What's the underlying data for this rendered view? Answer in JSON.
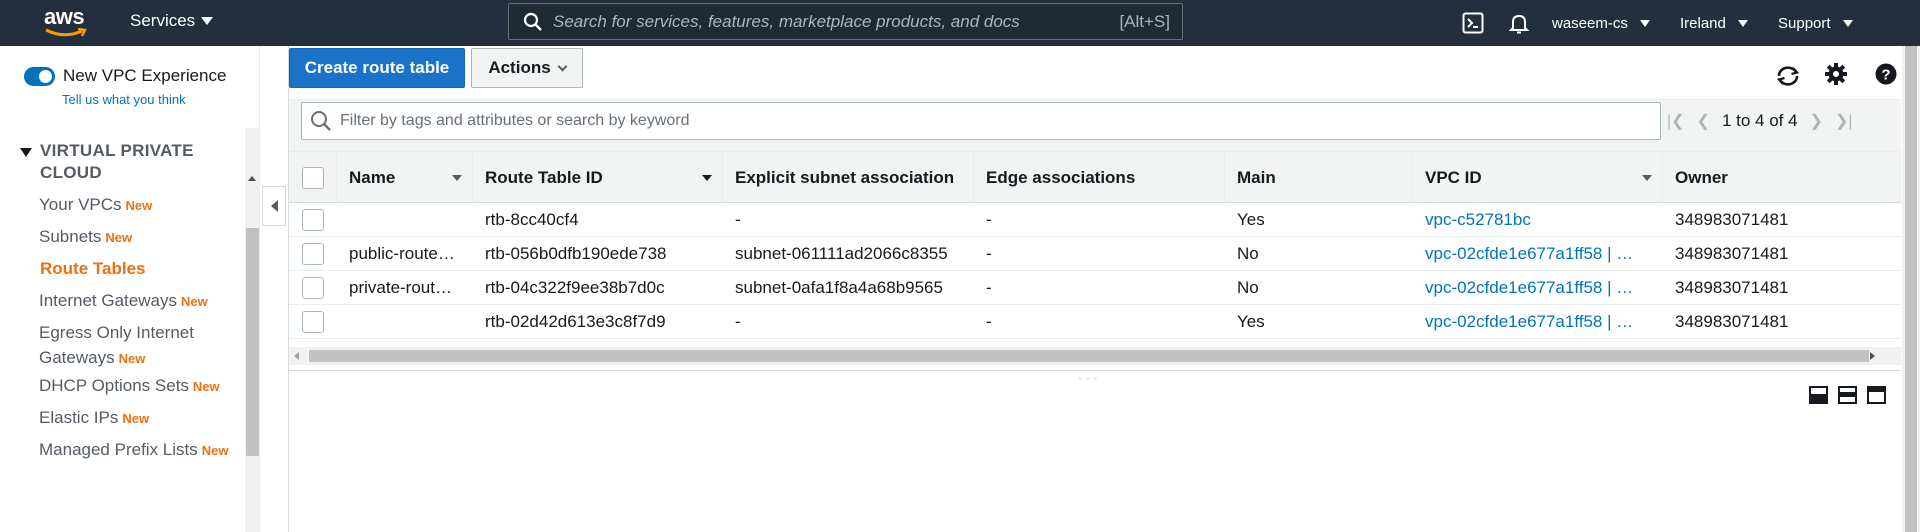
{
  "topnav": {
    "logo_text": "aws",
    "services_label": "Services",
    "search_placeholder": "Search for services, features, marketplace products, and docs",
    "search_shortcut": "[Alt+S]",
    "account_label": "waseem-cs",
    "region_label": "Ireland",
    "support_label": "Support",
    "icons": [
      "cloudshell-icon",
      "bell-icon"
    ]
  },
  "sidebar": {
    "toggle_label": "New VPC Experience",
    "toggle_on": true,
    "tell_us_link": "Tell us what you think",
    "section_title": "VIRTUAL PRIVATE CLOUD",
    "new_badge": "New",
    "items": [
      {
        "label": "Your VPCs",
        "badge": "New"
      },
      {
        "label": "Subnets",
        "badge": "New"
      },
      {
        "label": "Route Tables",
        "badge": "",
        "active": true
      },
      {
        "label": "Internet Gateways",
        "badge": "New"
      },
      {
        "label": "Egress Only Internet Gateways",
        "badge": "New"
      },
      {
        "label": "DHCP Options Sets",
        "badge": "New"
      },
      {
        "label": "Elastic IPs",
        "badge": "New"
      },
      {
        "label": "Managed Prefix Lists",
        "badge": "New"
      }
    ]
  },
  "toolbar": {
    "create_label": "Create route table",
    "actions_label": "Actions",
    "icons": [
      "refresh-icon",
      "settings-icon",
      "help-icon"
    ]
  },
  "filter": {
    "placeholder": "Filter by tags and attributes or search by keyword"
  },
  "pager": {
    "text": "1 to 4 of 4"
  },
  "table": {
    "columns": [
      "Name",
      "Route Table ID",
      "Explicit subnet association",
      "Edge associations",
      "Main",
      "VPC ID",
      "Owner"
    ],
    "rows": [
      {
        "name": "",
        "id": "rtb-8cc40cf4",
        "subnet": "-",
        "edge": "-",
        "main": "Yes",
        "vpc": "vpc-c52781bc",
        "owner": "348983071481"
      },
      {
        "name": "public-route…",
        "id": "rtb-056b0dfb190ede738",
        "subnet": "subnet-061111ad2066c8355",
        "edge": "-",
        "main": "No",
        "vpc": "vpc-02cfde1e677a1ff58 | …",
        "owner": "348983071481"
      },
      {
        "name": "private-rout…",
        "id": "rtb-04c322f9ee38b7d0c",
        "subnet": "subnet-0afa1f8a4a68b9565",
        "edge": "-",
        "main": "No",
        "vpc": "vpc-02cfde1e677a1ff58 | …",
        "owner": "348983071481"
      },
      {
        "name": "",
        "id": "rtb-02d42d613e3c8f7d9",
        "subnet": "-",
        "edge": "-",
        "main": "Yes",
        "vpc": "vpc-02cfde1e677a1ff58 | …",
        "owner": "348983071481"
      }
    ]
  },
  "colors": {
    "nav_bg": "#232f3e",
    "primary": "#1a73c8",
    "link": "#0073bb",
    "active": "#ec7211"
  }
}
